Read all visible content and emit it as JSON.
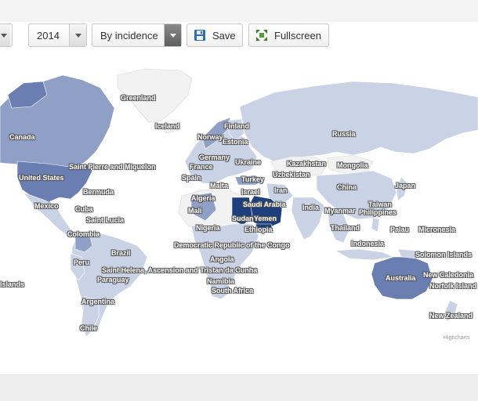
{
  "toolbar": {
    "year_value": "2014",
    "mode_value": "By incidence",
    "save_label": "Save",
    "fullscreen_label": "Fullscreen"
  },
  "colors": {
    "no_data": "#f2f2f2",
    "low": "#c9d3e5",
    "mid": "#8f9fc6",
    "high": "#6a7eb2",
    "highest": "#1d3f7c",
    "ocean": "#ffffff"
  },
  "icons": {
    "save": "floppy-disk",
    "fullscreen": "expand-arrows"
  },
  "map": {
    "credits": "Highcharts",
    "labels": {
      "greenland": "Greenland",
      "iceland": "Iceland",
      "finland": "Finland",
      "norway": "Norway",
      "estonia": "Estonia",
      "russia": "Russia",
      "canada": "Canada",
      "united_states": "United States",
      "saint_pierre": "Saint Pierre and Miquelon",
      "germany": "Germany",
      "ukraine": "Ukraine",
      "france": "France",
      "kazakhstan": "Kazakhstan",
      "mongolia": "Mongolia",
      "uzbekistan": "Uzbekistan",
      "spain": "Spain",
      "turkey": "Turkey",
      "malta": "Malta",
      "israel": "Israel",
      "iran": "Iran",
      "china": "China",
      "japan": "Japan",
      "bermuda": "Bermuda",
      "algeria": "Algeria",
      "saudi_arabia": "Saudi Arabia",
      "mexico": "Mexico",
      "mali": "Mali",
      "sudan": "Sudan",
      "yemen": "Yemen",
      "india": "India",
      "myanmar": "Myanmar",
      "taiwan": "Taiwan",
      "philippines": "Philippines",
      "cuba": "Cuba",
      "saint_lucia": "Saint Lucia",
      "thailand": "Thailand",
      "palau": "Palau",
      "micronesia": "Micronesia",
      "nigeria": "Nigeria",
      "ethiopia": "Ethiopia",
      "colombia": "Colombia",
      "indonesia": "Indonesia",
      "solomon_islands": "Solomon Islands",
      "brazil": "Brazil",
      "drc": "Democratic Republic of the Congo",
      "peru": "Peru",
      "angola": "Angola",
      "saint_helena": "Saint Helena, Ascension and Tristan da Cunha",
      "islands_left": "Islands",
      "paraguay": "Paraguay",
      "namibia": "Namibia",
      "south_africa": "South Africa",
      "australia": "Australia",
      "new_caledonia": "New Caledonia",
      "norfolk_island": "Norfolk Island",
      "argentina": "Argentina",
      "new_zealand": "New Zealand",
      "chile": "Chile"
    }
  }
}
